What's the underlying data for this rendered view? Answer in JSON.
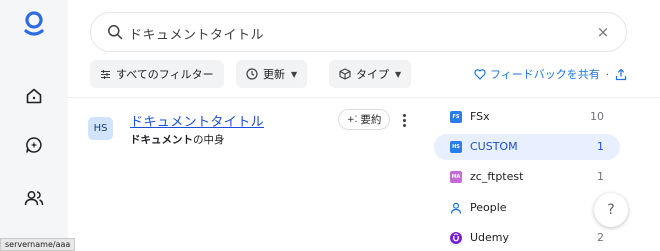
{
  "rail": {
    "status_text": "servername/aaa"
  },
  "search": {
    "query": "ドキュメントタイトル",
    "clear_symbol": "×"
  },
  "filters": {
    "all_filters_label": "すべてのフィルター",
    "updated_label": "更新",
    "type_label": "タイプ"
  },
  "feedback": {
    "label": "フィードバックを共有",
    "separator": "·"
  },
  "result": {
    "avatar_initials": "HS",
    "title": "ドキュメントタイトル",
    "snippet_bold": "ドキュメント",
    "snippet_rest": "の中身",
    "summary_label": "要約"
  },
  "sources": [
    {
      "label": "FSx",
      "count": "10",
      "icon": "fs-icon",
      "icon_text": "FS",
      "color": "#2b7de9",
      "active": false
    },
    {
      "label": "CUSTOM",
      "count": "1",
      "icon": "hs-icon",
      "icon_text": "HS",
      "color": "#2b7de9",
      "active": true
    },
    {
      "label": "zc_ftptest",
      "count": "1",
      "icon": "ma-icon",
      "icon_text": "MA",
      "color": "#c26bd6",
      "active": false
    },
    {
      "label": "People",
      "count": "",
      "icon": "person-icon",
      "icon_text": "",
      "color": "#1a73e8",
      "active": false
    },
    {
      "label": "Udemy",
      "count": "2",
      "icon": "udemy-icon",
      "icon_text": "",
      "color": "#7a1fd6",
      "active": false
    }
  ],
  "help": {
    "label": "?"
  },
  "colors": {
    "accent": "#1a73e8",
    "rail_bg": "#f5f6f8",
    "active_row_bg": "#e8efff"
  }
}
